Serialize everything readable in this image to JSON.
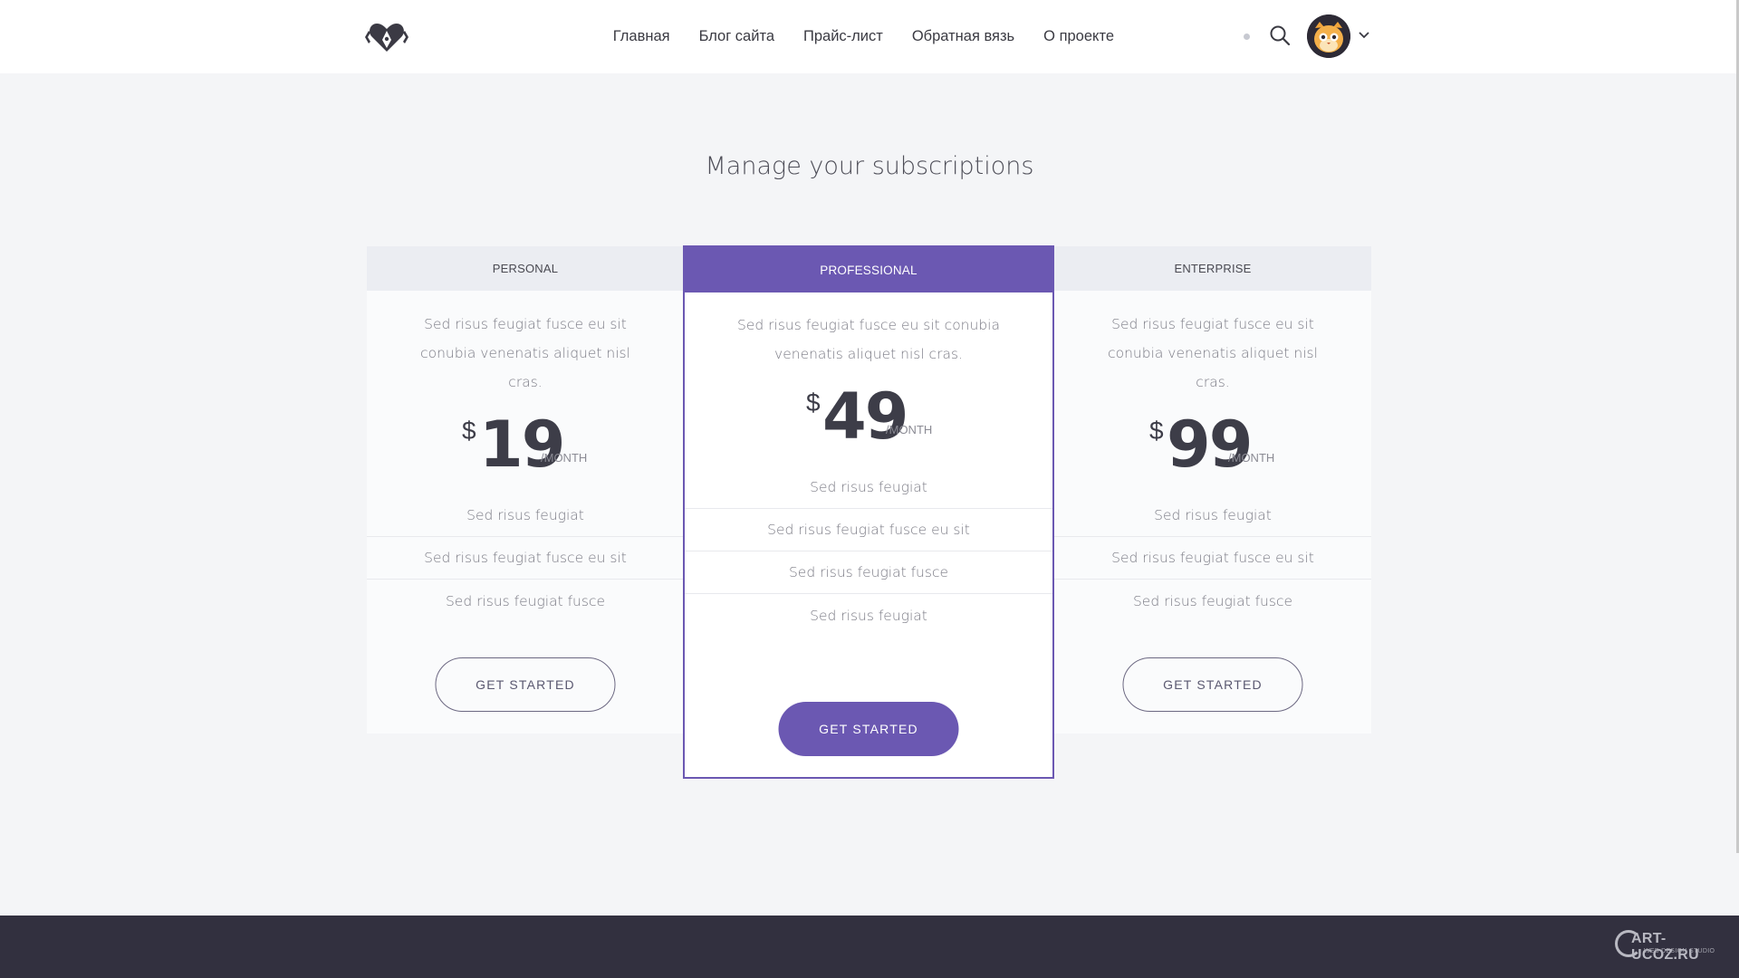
{
  "header": {
    "logo_icon": "heart-pen-logo-icon",
    "nav": [
      {
        "label": "Главная"
      },
      {
        "label": "Блог сайта"
      },
      {
        "label": "Прайс-лист"
      },
      {
        "label": "Обратная вязь"
      },
      {
        "label": "О проекте"
      }
    ],
    "search_icon": "search-icon",
    "avatar_icon": "cat-avatar-icon",
    "menu_icon": "chevron-down-icon"
  },
  "page": {
    "title": "Manage your subscriptions"
  },
  "plans": [
    {
      "name": "PERSONAL",
      "description": "Sed risus feugiat fusce eu sit conubia venenatis aliquet nisl cras.",
      "currency": "$",
      "price": "19",
      "period": "/MONTH",
      "features": [
        "Sed risus feugiat",
        "Sed risus feugiat fusce eu sit",
        "Sed risus feugiat fusce"
      ],
      "button": "GET STARTED"
    },
    {
      "name": "PROFESSIONAL",
      "description": "Sed risus feugiat fusce eu sit conubia venenatis aliquet nisl cras.",
      "currency": "$",
      "price": "49",
      "period": "/MONTH",
      "features": [
        "Sed risus feugiat",
        "Sed risus feugiat fusce eu sit",
        "Sed risus feugiat fusce",
        "Sed risus feugiat"
      ],
      "button": "GET STARTED",
      "highlighted": true
    },
    {
      "name": "ENTERPRISE",
      "description": "Sed risus feugiat fusce eu sit conubia venenatis aliquet nisl cras.",
      "currency": "$",
      "price": "99",
      "period": "/MONTH",
      "features": [
        "Sed risus feugiat",
        "Sed risus feugiat fusce eu sit",
        "Sed risus feugiat fusce"
      ],
      "button": "GET STARTED"
    }
  ],
  "watermark": {
    "main": "ART-UCOZ.RU",
    "sub": "WEB DESIGN STUDIO"
  },
  "colors": {
    "accent": "#6b58b2",
    "page_bg": "#f4f5f7",
    "footer_bg": "#32303f",
    "header_bg": "#ffffff"
  }
}
